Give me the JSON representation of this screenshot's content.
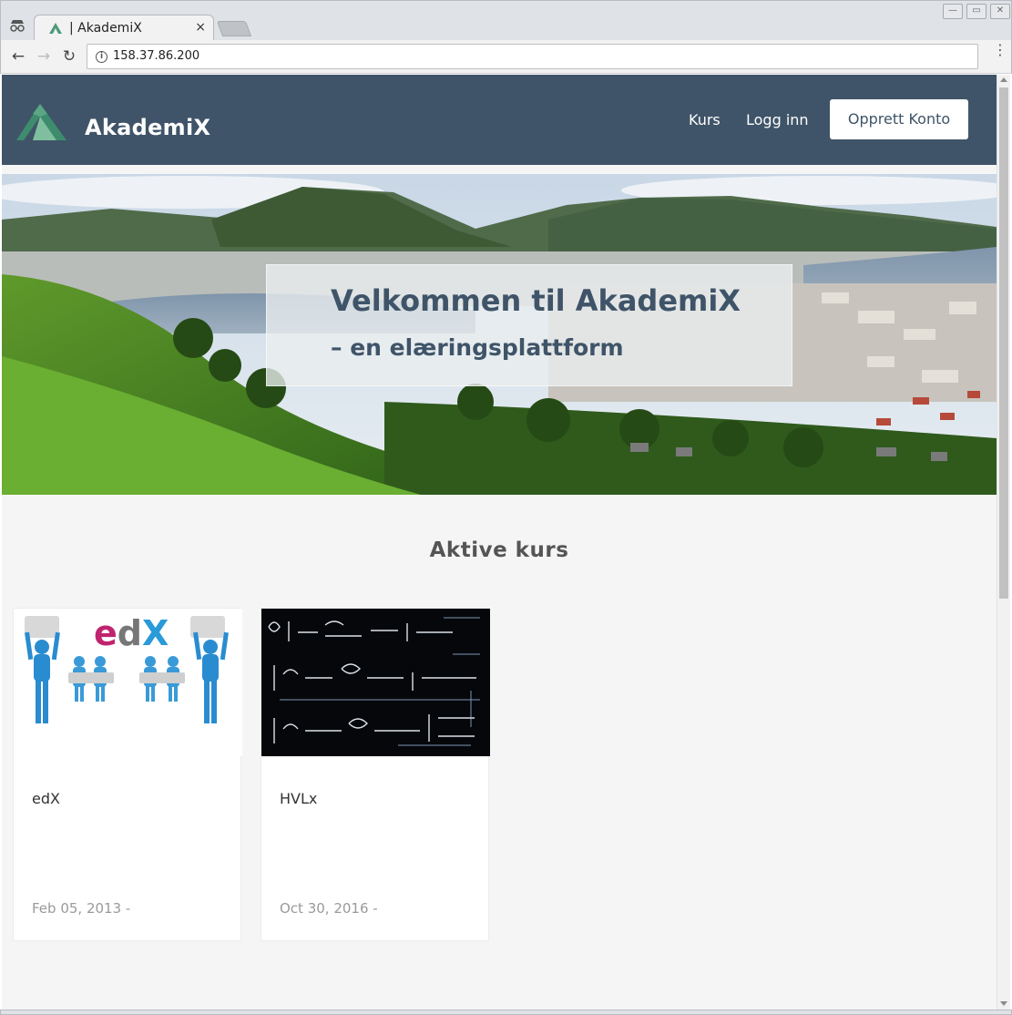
{
  "browser": {
    "tab_title": "| AkademiX",
    "tab_close": "×",
    "url": "158.37.86.200",
    "back": "←",
    "forward": "→",
    "reload": "↻"
  },
  "header": {
    "logo_text": "AkademiX",
    "nav": [
      {
        "label": "Kurs"
      },
      {
        "label": "Logg inn"
      }
    ],
    "signup_label": "Opprett Konto",
    "bg_color": "#3f5468"
  },
  "hero": {
    "title": "Velkommen til AkademiX",
    "subtitle": "– en elæringsplattform"
  },
  "courses": {
    "section_title": "Aktive kurs",
    "items": [
      {
        "name": "edX",
        "date": "Feb 05, 2013 -",
        "image_text": "edX"
      },
      {
        "name": "HVLx",
        "date": "Oct 30, 2016 -"
      }
    ]
  }
}
